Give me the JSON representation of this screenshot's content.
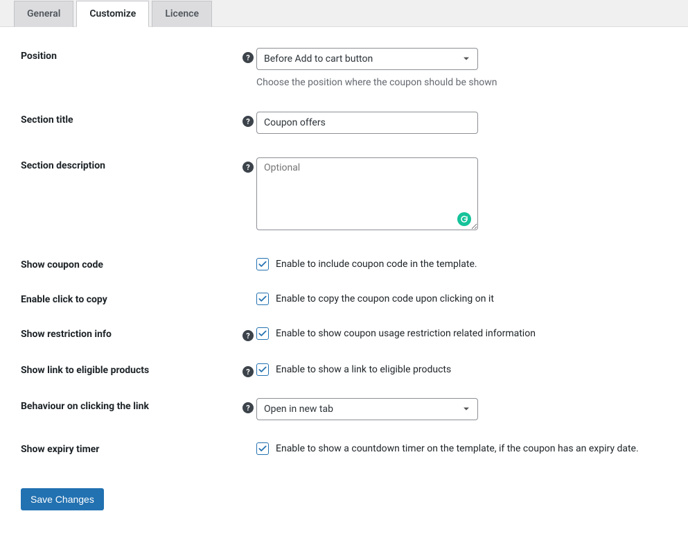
{
  "tabs": {
    "general": "General",
    "customize": "Customize",
    "licence": "Licence"
  },
  "fields": {
    "position": {
      "label": "Position",
      "value": "Before Add to cart button",
      "help_text": "Choose the position where the coupon should be shown"
    },
    "section_title": {
      "label": "Section title",
      "value": "Coupon offers"
    },
    "section_description": {
      "label": "Section description",
      "placeholder": "Optional",
      "value": ""
    },
    "show_coupon_code": {
      "label": "Show coupon code",
      "desc": "Enable to include coupon code in the template.",
      "checked": true
    },
    "enable_click_to_copy": {
      "label": "Enable click to copy",
      "desc": "Enable to copy the coupon code upon clicking on it",
      "checked": true
    },
    "show_restriction_info": {
      "label": "Show restriction info",
      "desc": "Enable to show coupon usage restriction related information",
      "checked": true
    },
    "show_link_eligible": {
      "label": "Show link to eligible products",
      "desc": "Enable to show a link to eligible products",
      "checked": true
    },
    "behaviour_click": {
      "label": "Behaviour on clicking the link",
      "value": "Open in new tab"
    },
    "show_expiry_timer": {
      "label": "Show expiry timer",
      "desc": "Enable to show a countdown timer on the template, if the coupon has an expiry date.",
      "checked": true
    }
  },
  "buttons": {
    "save": "Save Changes"
  },
  "icons": {
    "help_glyph": "?"
  }
}
